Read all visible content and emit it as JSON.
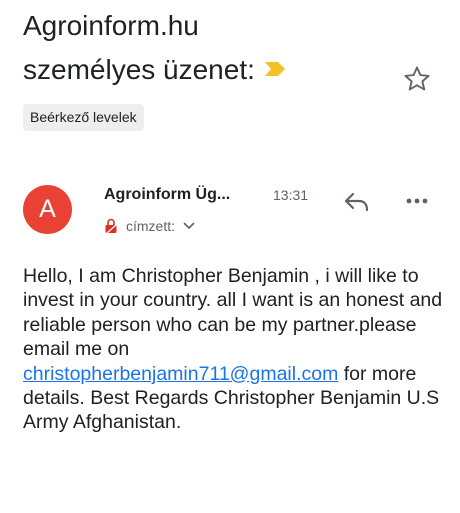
{
  "email": {
    "subject_line1": "Agroinform.hu",
    "subject_line2": "személyes üzenet:",
    "label": "Beérkező levelek",
    "sender": {
      "avatar_letter": "A",
      "avatar_color": "#e94235",
      "name": "Agroinform Üg...",
      "time": "13:31",
      "recipient_label": "címzett:"
    },
    "body": {
      "part1": "Hello, I am Christopher Benjamin , i will like to invest in your country. all I want is an honest and reliable person who can be my partner.please email me on ",
      "link": "christopherbenjamin711@gmail.com",
      "part2": " for more details. Best Regards Christopher Benjamin U.S Army Afghanistan."
    }
  },
  "icons": {
    "importance": "importance-marker-icon",
    "star": "star-icon",
    "lock": "lock-icon",
    "chevron": "chevron-down-icon",
    "reply": "reply-icon",
    "more": "more-icon"
  },
  "colors": {
    "importance": "#f6bf26",
    "link": "#1a73e8",
    "lock": "#d93025"
  }
}
